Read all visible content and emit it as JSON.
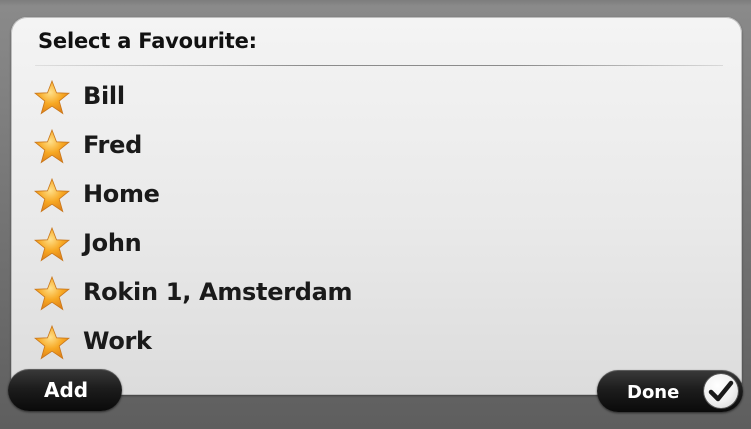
{
  "screen": {
    "title": "Select a Favourite:"
  },
  "favourites": [
    {
      "label": "Bill",
      "icon": "star-icon"
    },
    {
      "label": "Fred",
      "icon": "star-icon"
    },
    {
      "label": "Home",
      "icon": "star-icon"
    },
    {
      "label": "John",
      "icon": "star-icon"
    },
    {
      "label": "Rokin 1, Amsterdam",
      "icon": "star-icon"
    },
    {
      "label": "Work",
      "icon": "star-icon"
    }
  ],
  "buttons": {
    "add_label": "Add",
    "done_label": "Done",
    "done_icon": "checkmark-icon"
  },
  "colors": {
    "star_fill": "#f7a823",
    "star_highlight": "#ffd66b",
    "button_bg": "#1b1b1b",
    "panel_bg": "#ececec"
  }
}
